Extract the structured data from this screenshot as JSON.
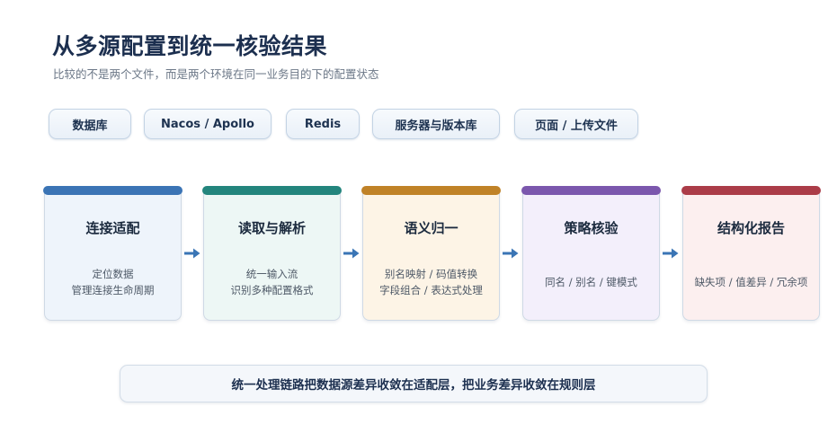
{
  "header": {
    "title": "从多源配置到统一核验结果",
    "subtitle": "比较的不是两个文件，而是两个环境在同一业务目的下的配置状态"
  },
  "sources": [
    {
      "label": "数据库"
    },
    {
      "label": "Nacos / Apollo"
    },
    {
      "label": "Redis"
    },
    {
      "label": "服务器与版本库"
    },
    {
      "label": "页面 / 上传文件"
    }
  ],
  "steps": [
    {
      "title": "连接适配",
      "lines": [
        "定位数据",
        "管理连接生命周期"
      ],
      "accent": "#3b74b5",
      "fill": "#eef4fb"
    },
    {
      "title": "读取与解析",
      "lines": [
        "统一输入流",
        "识别多种配置格式"
      ],
      "accent": "#23857d",
      "fill": "#edf7f5"
    },
    {
      "title": "语义归一",
      "lines": [
        "别名映射 / 码值转换",
        "字段组合 / 表达式处理"
      ],
      "accent": "#c08227",
      "fill": "#fdf4e6"
    },
    {
      "title": "策略核验",
      "lines": [
        "同名 / 别名 / 键模式"
      ],
      "accent": "#7b57ad",
      "fill": "#f3effb"
    },
    {
      "title": "结构化报告",
      "lines": [
        "缺失项 / 值差异 / 冗余项"
      ],
      "accent": "#ab3c48",
      "fill": "#fcefef"
    }
  ],
  "arrow_color": "#3a75b5",
  "footer": {
    "note": "统一处理链路把数据源差异收敛在适配层，把业务差异收敛在规则层"
  }
}
